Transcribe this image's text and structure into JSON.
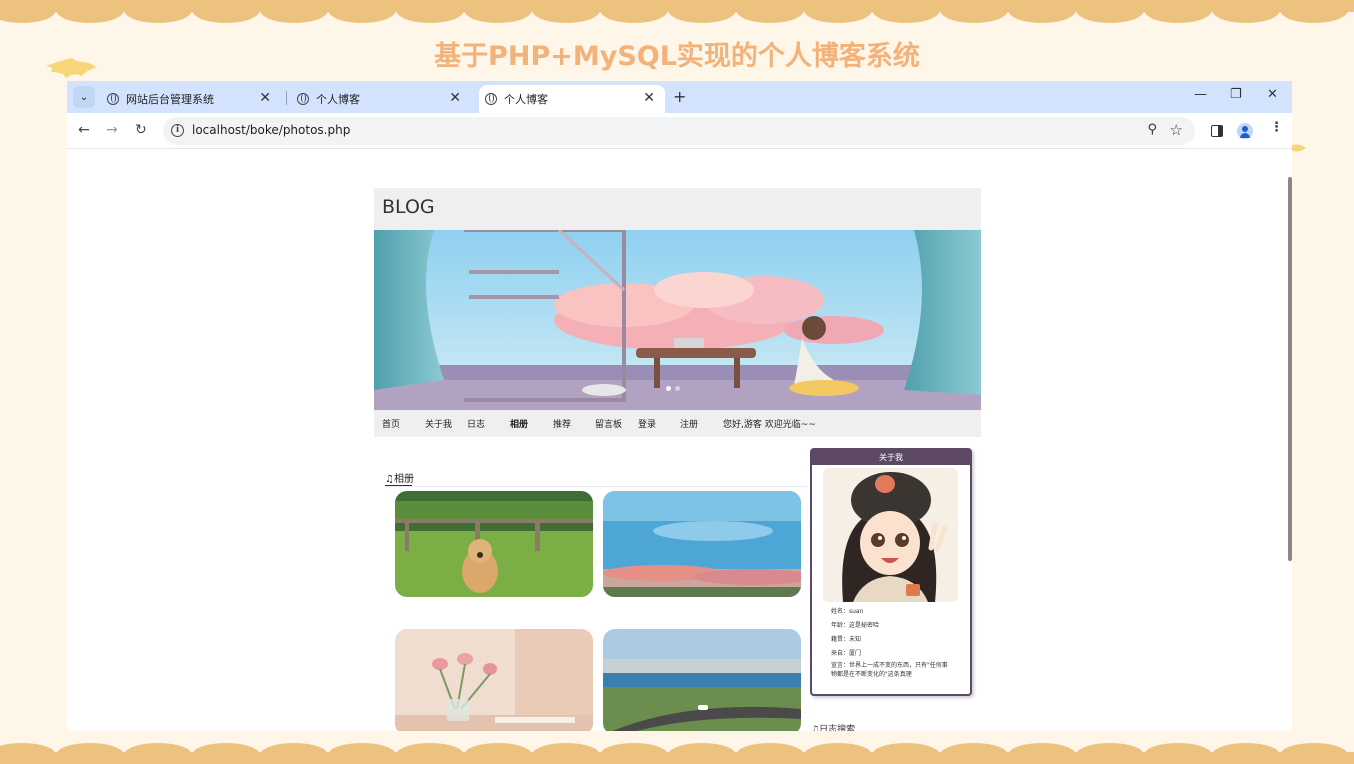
{
  "slide": {
    "title": "基于PHP+MySQL实现的个人博客系统"
  },
  "browser": {
    "tabs": [
      {
        "label": "网站后台管理系统",
        "close": "✕"
      },
      {
        "label": "个人博客",
        "close": "✕"
      },
      {
        "label": "个人博客",
        "close": "✕",
        "active": true
      }
    ],
    "new_tab": "+",
    "window_controls": {
      "minimize": "—",
      "restore": "❐",
      "close": "✕"
    },
    "url": "localhost/boke/photos.php",
    "icons": [
      "tab-list-icon",
      "globe-icon",
      "back-icon",
      "forward-icon",
      "reload-icon",
      "info-icon",
      "zoom-icon",
      "star-icon",
      "side-panel-icon",
      "profile-icon",
      "menu-icon"
    ]
  },
  "blog": {
    "brand": "BLOG",
    "nav": [
      {
        "label": "首页"
      },
      {
        "label": "关于我"
      },
      {
        "label": "日志"
      },
      {
        "label": "相册"
      },
      {
        "label": "推荐"
      },
      {
        "label": "留言板"
      },
      {
        "label": "登录"
      },
      {
        "label": "注册"
      },
      {
        "label": "您好,游客 欢迎光临~~"
      }
    ],
    "album": {
      "title": "♫相册"
    },
    "photos": [
      {
        "subject": "golden retriever on lawn"
      },
      {
        "subject": "sea and flowers"
      },
      {
        "subject": "tulips in glass vase"
      },
      {
        "subject": "lakeside road"
      }
    ],
    "about": {
      "heading": "关于我",
      "name": "姓名：suan",
      "age": "年龄：这是秘密哈",
      "hobby": "籍贯：未知",
      "from": "来自：厦门",
      "motto": "宣言：世界上一成不变的东西，只有\"任何事物都是在不断变化的\"这条真理"
    },
    "search": {
      "title": "♫日志搜索"
    }
  },
  "colors": {
    "accent": "#5d4963",
    "tabbar": "#d3e3fd",
    "title": "#f3b27a",
    "band": "#edc27f"
  }
}
